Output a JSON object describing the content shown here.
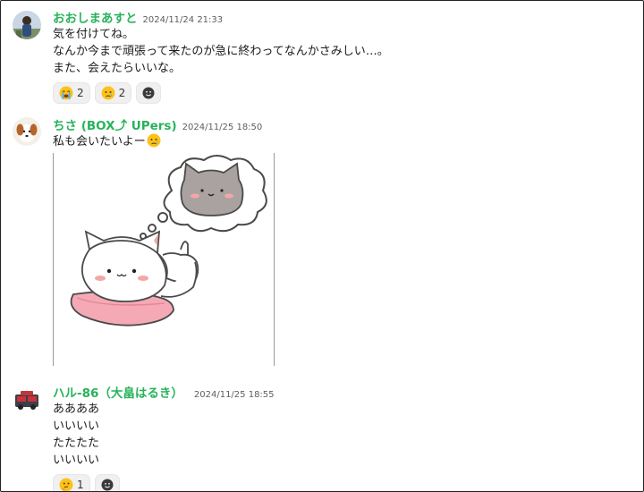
{
  "messages": [
    {
      "author": "おおしまあすと",
      "timestamp": "2024/11/24 21:33",
      "lines": [
        "気を付けてね。",
        "なんか今まで頑張って来たのが急に終わってなんかさみしい…。",
        "また、会えたらいいな。"
      ],
      "reactions": [
        {
          "emoji": "loudly-crying-face",
          "count": "2"
        },
        {
          "emoji": "crying-face",
          "count": "2"
        }
      ]
    },
    {
      "author": "ちさ (BOX⤴ UPers)",
      "timestamp": "2024/11/25 18:50",
      "text": "私も会いたいよー",
      "trailing_emoji": "crying-face",
      "attachment": "sticker-cat-thinking"
    },
    {
      "author": "ハル-86（大畠はるき）",
      "timestamp": "2024/11/25 18:55",
      "lines": [
        "ああああ",
        "いいいい",
        "たたたた",
        "いいいい"
      ],
      "reactions": [
        {
          "emoji": "thinking-face",
          "count": "1"
        }
      ]
    }
  ],
  "colors": {
    "author": "#27b35a",
    "timestamp": "#5e5e5e",
    "reaction_bg": "#f0f0f0"
  }
}
